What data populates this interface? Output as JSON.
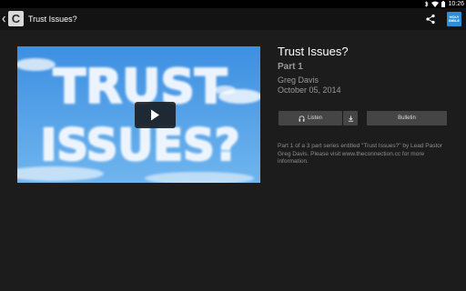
{
  "status_bar": {
    "time": "10:26",
    "icons": [
      "bluetooth-icon",
      "wifi-icon",
      "battery-icon"
    ]
  },
  "action_bar": {
    "title": "Trust Issues?",
    "icons": [
      "back-chevron-icon",
      "app-logo-icon",
      "share-icon",
      "bible-app-icon"
    ],
    "bible_icon_text": [
      "HOLY",
      "BIBLE"
    ]
  },
  "video": {
    "thumbnail_text": [
      "TRUST",
      "ISSUES?"
    ],
    "sky_color": "#3a8ee0",
    "play_icon": "play-icon"
  },
  "sermon": {
    "title": "Trust Issues?",
    "part": "Part 1",
    "speaker": "Greg Davis",
    "date": "October 05, 2014",
    "description": "Part 1 of a 3 part series entitled \"Trust Issues?\" by Lead Pastor Greg Davis. Please visit www.theconnection.cc for more information."
  },
  "buttons": {
    "listen_label": "Listen",
    "listen_icon": "headphones-icon",
    "download_icon": "download-icon",
    "bulletin_label": "Bulletin"
  },
  "colors": {
    "background": "#1c1c1c",
    "action_bar": "#131313",
    "button": "#454545",
    "secondary_text": "#9a9a9a"
  }
}
